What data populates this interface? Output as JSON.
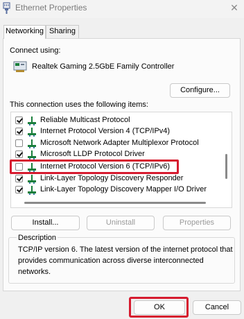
{
  "window": {
    "title": "Ethernet Properties",
    "close_glyph": "✕"
  },
  "tabs": [
    {
      "label": "Networking",
      "active": true
    },
    {
      "label": "Sharing",
      "active": false
    }
  ],
  "connect_using": {
    "label": "Connect using:",
    "adapter": "Realtek Gaming 2.5GbE Family Controller",
    "adapter_icon": "network-adapter-icon"
  },
  "buttons": {
    "configure": "Configure...",
    "install": "Install...",
    "uninstall": "Uninstall",
    "properties": "Properties",
    "ok": "OK",
    "cancel": "Cancel"
  },
  "items_label": "This connection uses the following items:",
  "items": [
    {
      "label": "Reliable Multicast Protocol",
      "checked": true,
      "icon": "protocol-icon"
    },
    {
      "label": "Internet Protocol Version 4 (TCP/IPv4)",
      "checked": true,
      "icon": "protocol-icon"
    },
    {
      "label": "Microsoft Network Adapter Multiplexor Protocol",
      "checked": false,
      "icon": "protocol-icon"
    },
    {
      "label": "Microsoft LLDP Protocol Driver",
      "checked": true,
      "icon": "protocol-icon"
    },
    {
      "label": "Internet Protocol Version 6 (TCP/IPv6)",
      "checked": false,
      "icon": "protocol-icon",
      "highlighted": true
    },
    {
      "label": "Link-Layer Topology Discovery Responder",
      "checked": true,
      "icon": "protocol-icon"
    },
    {
      "label": "Link-Layer Topology Discovery Mapper I/O Driver",
      "checked": true,
      "icon": "protocol-icon"
    }
  ],
  "description": {
    "title": "Description",
    "text": "TCP/IP version 6. The latest version of the internet protocol that provides communication across diverse interconnected networks."
  },
  "colors": {
    "highlight": "#d61b2f",
    "accent": "#1a7f3c"
  }
}
